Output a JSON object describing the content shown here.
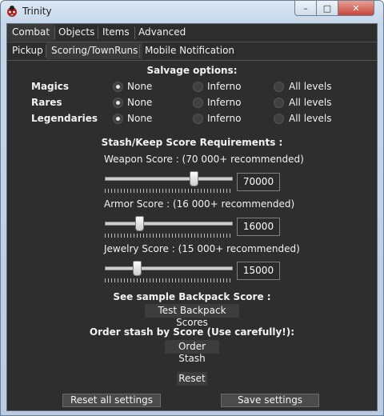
{
  "window": {
    "title": "Trinity"
  },
  "tabs_top": [
    "Combat",
    "Objects",
    "Items",
    "Advanced"
  ],
  "tabs_sub": [
    "Pickup",
    "Scoring/TownRuns",
    "Mobile Notification"
  ],
  "salvage": {
    "heading": "Salvage options:",
    "options": [
      "None",
      "Inferno",
      "All levels"
    ],
    "rows": [
      {
        "label": "Magics",
        "selected": "None"
      },
      {
        "label": "Rares",
        "selected": "None"
      },
      {
        "label": "Legendaries",
        "selected": "None"
      }
    ]
  },
  "score": {
    "heading": "Stash/Keep Score Requirements :",
    "weapon": {
      "label": "Weapon Score : (70 000+ recommended)",
      "value": "70000",
      "level": 0.7
    },
    "armor": {
      "label": "Armor Score : (16 000+ recommended)",
      "value": "16000",
      "level": 0.27
    },
    "jewelry": {
      "label": "Jewelry Score : (15 000+ recommended)",
      "value": "15000",
      "level": 0.25
    }
  },
  "backpack": {
    "heading": "See sample Backpack Score :",
    "button": "Test Backpack Scores"
  },
  "orderstash": {
    "heading": "Order stash by Score (Use carefully!):",
    "button": "Order Stash"
  },
  "footer": {
    "reset": "Reset",
    "reset_all": "Reset all settings",
    "save": "Save settings"
  },
  "colors": {
    "panel": "#2e2e2e",
    "text": "#f2f2f2",
    "close_button": "#c8453a"
  },
  "icons": {
    "app": "bug-icon"
  }
}
